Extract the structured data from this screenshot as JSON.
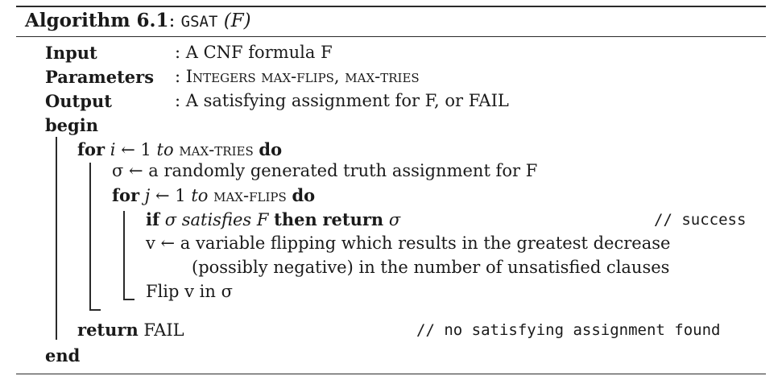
{
  "caption": {
    "label": "Algorithm 6.1",
    "sep": ":",
    "name": "GSAT",
    "arg": "(F)"
  },
  "header": {
    "input_label": "Input",
    "input_text": ": A CNF formula F",
    "parameters_label": "Parameters",
    "parameters_text": ": Integers max-flips, max-tries",
    "output_label": "Output",
    "output_text": ": A satisfying assignment for F, or FAIL"
  },
  "body": {
    "begin": "begin",
    "end": "end",
    "for1_kw": "for",
    "for1_var": "i",
    "for1_mid": "← 1",
    "for1_to": "to",
    "for1_limit": "max-tries",
    "for1_do": "do",
    "sigma_line": "σ ← a randomly generated truth assignment for F",
    "for2_kw": "for",
    "for2_var": "j",
    "for2_mid": "← 1",
    "for2_to": "to",
    "for2_limit": "max-flips",
    "for2_do": "do",
    "if_kw": "if",
    "if_sigma": "σ",
    "if_satisfies": "satisfies",
    "if_F": "F",
    "then_kw": "then",
    "return_kw_inner": "return",
    "return_sigma": "σ",
    "comment_success": "// success",
    "v_line_1": "v ← a variable flipping which results in the greatest decrease",
    "v_line_2": "(possibly negative) in the number of unsatisfied clauses",
    "flip_line": "Flip v in σ",
    "return_kw": "return",
    "return_fail": "FAIL",
    "comment_not_found": "// no satisfying assignment found"
  }
}
